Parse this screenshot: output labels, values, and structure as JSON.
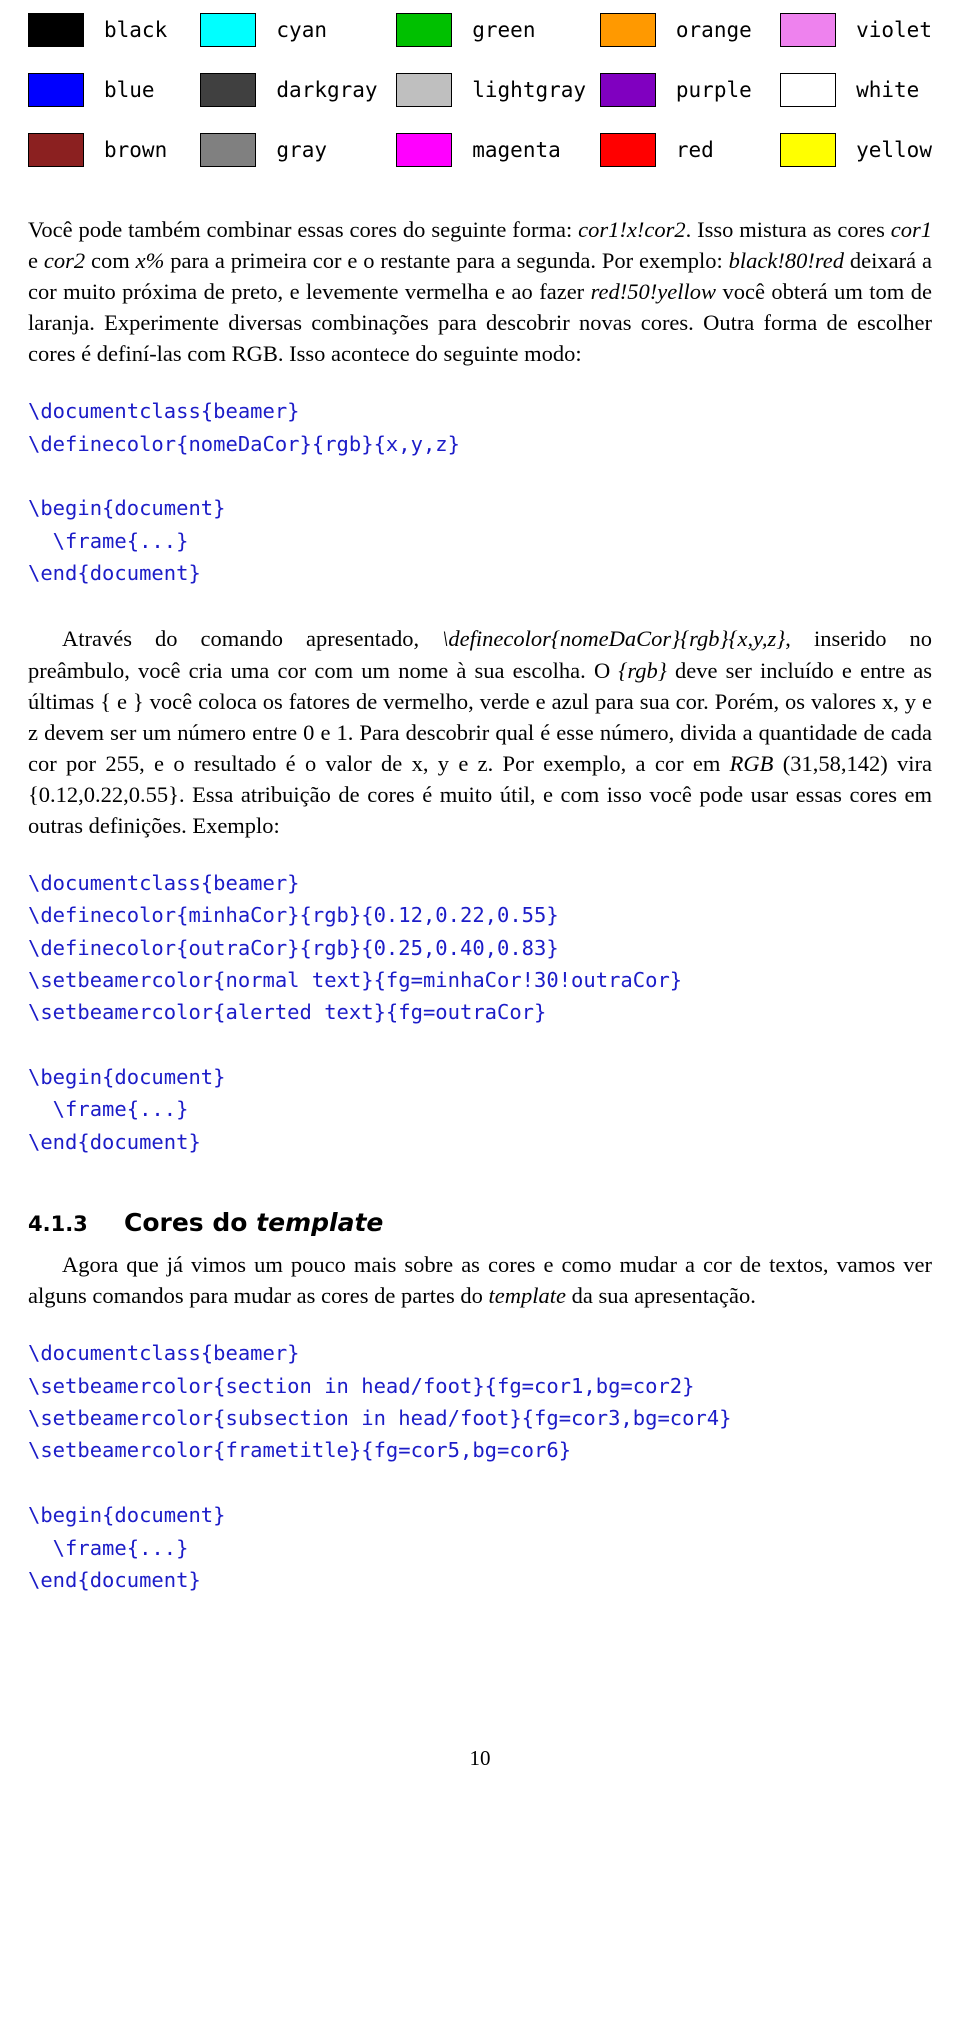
{
  "document": {
    "page_number": "10"
  },
  "swatches": {
    "rows": [
      [
        {
          "name": "black",
          "hex": "#000000"
        },
        {
          "name": "cyan",
          "hex": "#00ffff"
        },
        {
          "name": "green",
          "hex": "#00c000"
        },
        {
          "name": "orange",
          "hex": "#ff9900"
        },
        {
          "name": "violet",
          "hex": "#ee82ee"
        }
      ],
      [
        {
          "name": "blue",
          "hex": "#0000ff"
        },
        {
          "name": "darkgray",
          "hex": "#404040"
        },
        {
          "name": "lightgray",
          "hex": "#bfbfbf"
        },
        {
          "name": "purple",
          "hex": "#8000c0"
        },
        {
          "name": "white",
          "hex": "#ffffff"
        }
      ],
      [
        {
          "name": "brown",
          "hex": "#8b2020"
        },
        {
          "name": "gray",
          "hex": "#808080"
        },
        {
          "name": "magenta",
          "hex": "#ff00ff"
        },
        {
          "name": "red",
          "hex": "#ff0000"
        },
        {
          "name": "yellow",
          "hex": "#ffff00"
        }
      ]
    ]
  },
  "paragraphs": {
    "p1_part1": "Você pode também combinar essas cores do seguinte forma: ",
    "p1_mix": "cor1!x!cor2",
    "p1_part2": ". Isso mistura as cores ",
    "p1_cor1": "cor1",
    "p1_part3": " e ",
    "p1_cor2": "cor2",
    "p1_part4": " com ",
    "p1_x": "x%",
    "p1_part5": " para a primeira cor e o restante para a segunda. Por exemplo: ",
    "p1_ex1": "black!80!red",
    "p1_part6": " deixará a cor muito próxima de preto, e levemente vermelha e ao fazer ",
    "p1_ex2": "red!50!yellow",
    "p1_part7": " você obterá um tom de laranja. Experimente diversas combinações para descobrir novas cores. Outra forma de escolher cores é definí-las com RGB. Isso acontece do seguinte modo:",
    "p2_part1": "Através do comando apresentado, ",
    "p2_cmd": "\\definecolor{nomeDaCor}{rgb}{x,y,z}",
    "p2_part2": ", inserido no preâmbulo, você cria uma cor com um nome à sua escolha. O ",
    "p2_rgb": "{rgb}",
    "p2_part3": " deve ser incluído e entre as últimas { e } você coloca os fatores de vermelho, verde e azul para sua cor. Porém, os valores x, y e z devem ser um número entre 0 e 1. Para descobrir qual é esse número, divida a quantidade de cada cor por 255, e o resultado é o valor de x, y e z. Por exemplo, a cor em ",
    "p2_rgb2": "RGB",
    "p2_part4": " (31,58,142) vira {0.12,0.22,0.55}. Essa atribuição de cores é muito útil, e com isso você pode usar essas cores em outras definições. Exemplo:",
    "p3_part1": "Agora que já vimos um pouco mais sobre as cores e como mudar a cor de textos, vamos ver alguns comandos para mudar as cores de partes do ",
    "p3_template": "template",
    "p3_part2": " da sua apresentação."
  },
  "code_blocks": {
    "block1": [
      {
        "text": "\\documentclass{beamer}",
        "color": "blue"
      },
      {
        "text": "\\definecolor{nomeDaCor}{rgb}{x,y,z}",
        "color": "blue"
      },
      {
        "text": "",
        "color": "blue"
      },
      {
        "text": "\\begin{document}",
        "color": "blue"
      },
      {
        "text": "  \\frame{...}",
        "color": "blue"
      },
      {
        "text": "\\end{document}",
        "color": "blue"
      }
    ],
    "block2": [
      {
        "text": "\\documentclass{beamer}",
        "color": "blue"
      },
      {
        "text": "\\definecolor{minhaCor}{rgb}{0.12,0.22,0.55}",
        "color": "blue"
      },
      {
        "text": "\\definecolor{outraCor}{rgb}{0.25,0.40,0.83}",
        "color": "blue"
      },
      {
        "text": "\\setbeamercolor{normal text}{fg=minhaCor!30!outraCor}",
        "color": "blue"
      },
      {
        "text": "\\setbeamercolor{alerted text}{fg=outraCor}",
        "color": "blue"
      },
      {
        "text": "",
        "color": "blue"
      },
      {
        "text": "\\begin{document}",
        "color": "blue"
      },
      {
        "text": "  \\frame{...}",
        "color": "blue"
      },
      {
        "text": "\\end{document}",
        "color": "blue"
      }
    ],
    "block3": [
      {
        "text": "\\documentclass{beamer}",
        "color": "blue"
      },
      {
        "text": "\\setbeamercolor{section in head/foot}{fg=cor1,bg=cor2}",
        "color": "blue"
      },
      {
        "text": "\\setbeamercolor{subsection in head/foot}{fg=cor3,bg=cor4}",
        "color": "blue"
      },
      {
        "text": "\\setbeamercolor{frametitle}{fg=cor5,bg=cor6}",
        "color": "blue"
      },
      {
        "text": "",
        "color": "blue"
      },
      {
        "text": "\\begin{document}",
        "color": "blue"
      },
      {
        "text": "  \\frame{...}",
        "color": "blue"
      },
      {
        "text": "\\end{document}",
        "color": "blue"
      }
    ]
  },
  "section": {
    "number": "4.1.3",
    "title_part1": "Cores do ",
    "title_italic": "template"
  },
  "colors": {
    "code_blue": "#1c1cc8",
    "text_black": "#000000"
  }
}
